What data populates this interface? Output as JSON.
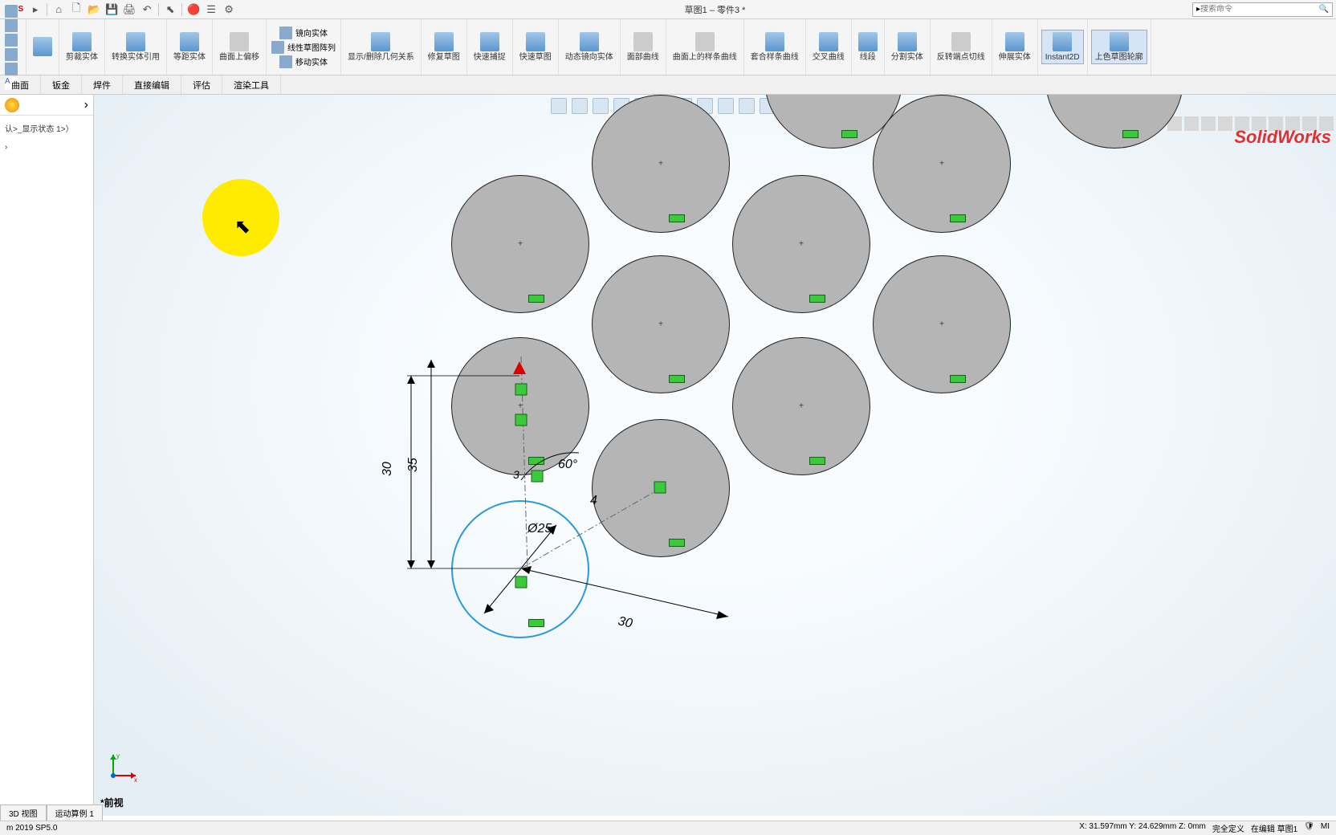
{
  "title": "草图1 – 零件3 *",
  "logo": "RKS",
  "watermark": "SolidWorks",
  "search_placeholder": "搜索命令",
  "ribbon": {
    "trim": "剪裁实体",
    "convert": "转换实体引用",
    "offset": "等距实体",
    "surfoff": "曲面上偏移",
    "mirror": "镜向实体",
    "linear": "线性草图阵列",
    "move": "移动实体",
    "showdel": "显示/删除几何关系",
    "repair": "修复草图",
    "quicksnap": "快速捕捉",
    "rapid": "快速草图",
    "dynmirror": "动态镜向实体",
    "planar": "面部曲线",
    "surface_curve": "曲面上的样条曲线",
    "fit_spline": "套合样条曲线",
    "intersection": "交叉曲线",
    "segment": "线段",
    "split": "分割实体",
    "rotate_copy": "反转端点切线",
    "extend": "伸展实体",
    "instant2d": "Instant2D",
    "shaded": "上色草图轮廓"
  },
  "tabs": {
    "surface": "曲面",
    "sheetmetal": "钣金",
    "weld": "焊件",
    "direct": "直接编辑",
    "evaluate": "评估",
    "render": "渲染工具"
  },
  "tree": {
    "state": "认>_显示状态 1>）"
  },
  "dims": {
    "dia": "Ø25",
    "h30": "30",
    "h35": "35",
    "ang": "60°",
    "len4": "4",
    "len30b": "30",
    "small3": "3"
  },
  "view_label": "*前视",
  "bottom_tabs": {
    "3d": "3D 视图",
    "motion": "运动算例 1"
  },
  "version": "m 2019 SP5.0",
  "status": {
    "coords": "X: 31.597mm Y: 24.629mm Z: 0mm",
    "defined": "完全定义",
    "editing": "在编辑 草图1",
    "unit": "MI"
  }
}
